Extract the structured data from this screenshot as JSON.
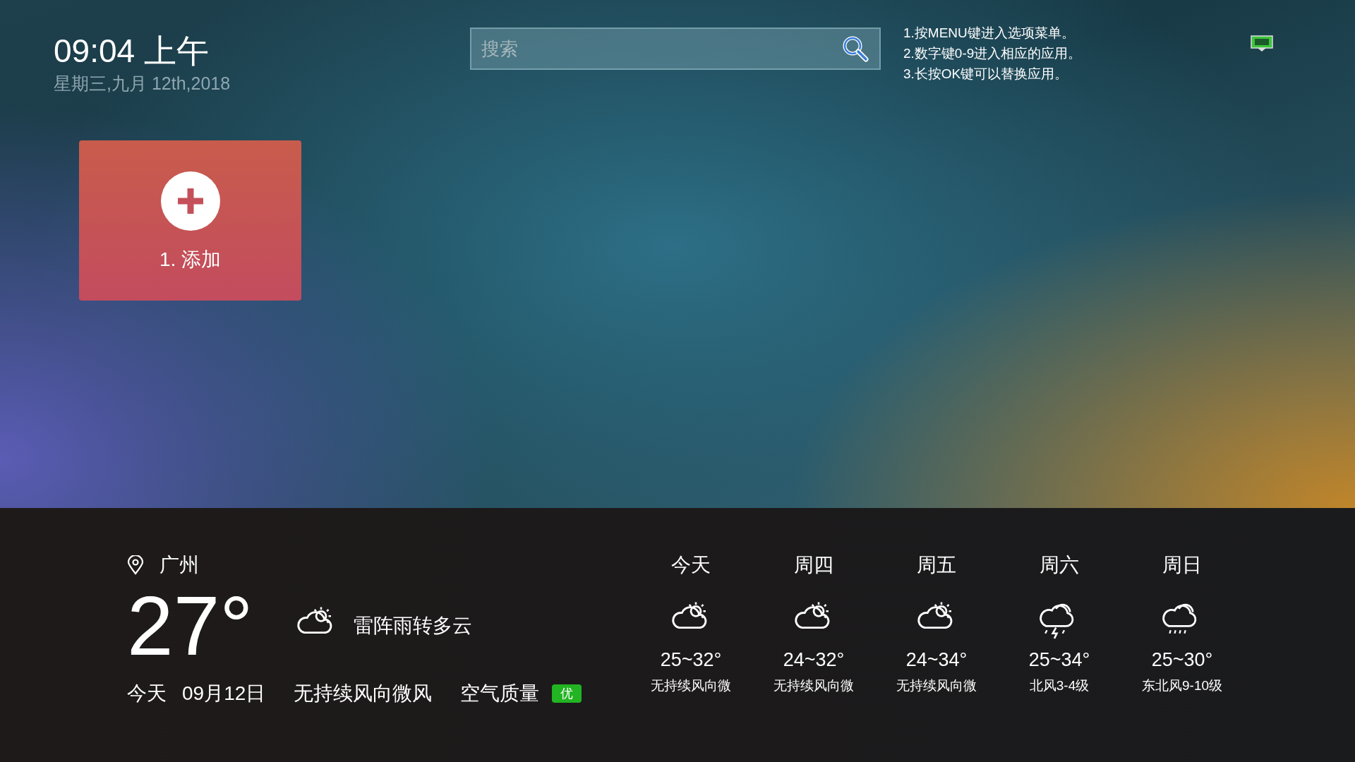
{
  "clock": {
    "time": "09:04 上午",
    "date": "星期三,九月 12th,2018"
  },
  "search": {
    "placeholder": "搜索"
  },
  "tips": [
    "1.按MENU键进入选项菜单。",
    "2.数字键0-9进入相应的应用。",
    "3.长按OK键可以替换应用。"
  ],
  "network": {
    "connected": true
  },
  "apps": [
    {
      "label": "1. 添加",
      "kind": "add"
    }
  ],
  "weather": {
    "city": "广州",
    "temperature": "27°",
    "condition": "雷阵雨转多云",
    "kind": "cloud-sun",
    "day": "今天",
    "date": "09月12日",
    "wind": "无持续风向微风",
    "air_quality": {
      "label": "空气质量",
      "badge": "优",
      "color": "#22b422"
    },
    "forecast": [
      {
        "day": "今天",
        "kind": "cloud-sun",
        "range": "25~32°",
        "wind": "无持续风向微"
      },
      {
        "day": "周四",
        "kind": "cloud-sun",
        "range": "24~32°",
        "wind": "无持续风向微"
      },
      {
        "day": "周五",
        "kind": "cloud-sun",
        "range": "24~34°",
        "wind": "无持续风向微"
      },
      {
        "day": "周六",
        "kind": "thunder",
        "range": "25~34°",
        "wind": "北风3-4级"
      },
      {
        "day": "周日",
        "kind": "rain",
        "range": "25~30°",
        "wind": "东北风9-10级"
      }
    ]
  }
}
